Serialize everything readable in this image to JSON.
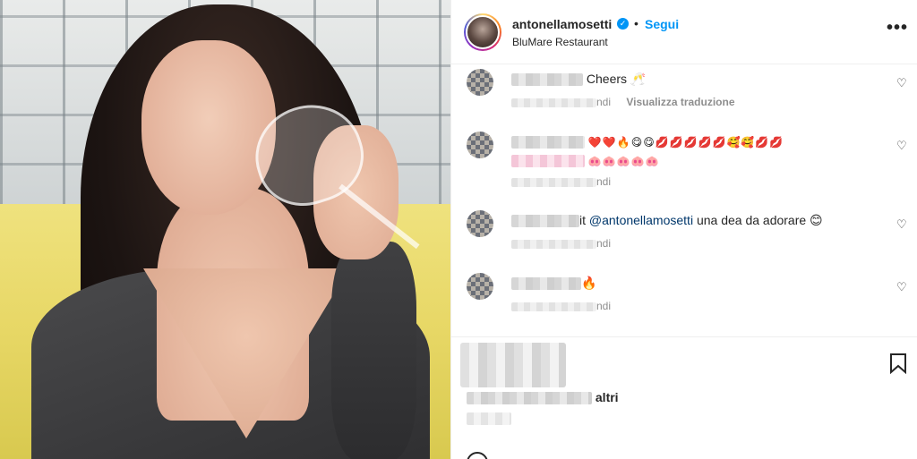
{
  "header": {
    "username": "antonellamosetti",
    "verified_icon": "verified-badge-icon",
    "separator": "•",
    "follow_label": "Segui",
    "location": "BluMare Restaurant",
    "more_label": "•••"
  },
  "comments": [
    {
      "text": "Cheers 🥂",
      "meta_suffix": "ndi",
      "translate": "Visualizza traduzione"
    },
    {
      "emojis_line1": "❤️❤️🔥😋😋💋💋💋💋💋🥰🥰💋💋",
      "emojis_line2": "🐽🐽🐽🐽🐽",
      "meta_suffix": "ndi"
    },
    {
      "prefix": "it",
      "mention": "@antonellamosetti",
      "text": " una dea da adorare 😊",
      "meta_suffix": "ndi"
    },
    {
      "text": "🔥",
      "meta_suffix": "ndi"
    }
  ],
  "actions": {
    "likes_suffix": "altri"
  },
  "colors": {
    "accent": "#0095f6",
    "text": "#262626",
    "muted": "#8e8e8e"
  }
}
